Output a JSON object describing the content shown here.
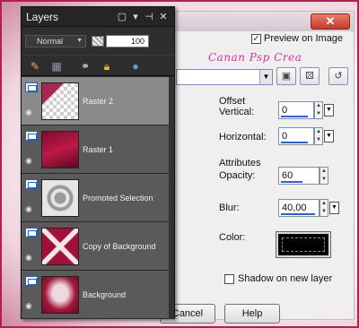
{
  "layers_panel": {
    "title": "Layers",
    "title_icons": [
      "window-icon",
      "dropdown-icon",
      "pin-icon",
      "close-icon"
    ],
    "blend_mode": "Normal",
    "opacity": "100",
    "toolbar_icons": [
      "new-raster-layer-icon",
      "new-mask-layer-icon",
      "link-icon",
      "lock-icon",
      "merge-icon"
    ],
    "layers": [
      {
        "name": "Raster 2",
        "thumb": "transparent-checker-with-red-shape",
        "selected": true
      },
      {
        "name": "Raster 1",
        "thumb": "dark-red-gradient"
      },
      {
        "name": "Promoted Selection",
        "thumb": "gray-swirl-on-checker"
      },
      {
        "name": "Copy of Background",
        "thumb": "red-x-pattern"
      },
      {
        "name": "Background",
        "thumb": "maroon-cloud-pattern"
      }
    ]
  },
  "drop_shadow_dialog": {
    "close_label": "✕",
    "preview_on_image_label": "Preview on Image",
    "preview_checked": true,
    "watermark": "Canan Psp Crea",
    "offset_group_label": "Offset",
    "vertical_label": "Vertical:",
    "vertical_value": "0",
    "horizontal_label": "Horizontal:",
    "horizontal_value": "0",
    "attributes_group_label": "Attributes",
    "opacity_label": "Opacity:",
    "opacity_value": "60",
    "blur_label": "Blur:",
    "blur_value": "40,00",
    "color_label": "Color:",
    "color_value": "#000000",
    "shadow_on_new_layer_label": "Shadow on new layer",
    "shadow_on_new_layer_checked": false,
    "cancel_label": "Cancel",
    "help_label": "Help"
  },
  "colors": {
    "frame_border": "#b02050",
    "panel_background": "#2e2e2e",
    "selected_layer": "#8a8a8a",
    "watermark": "#d0359a"
  }
}
